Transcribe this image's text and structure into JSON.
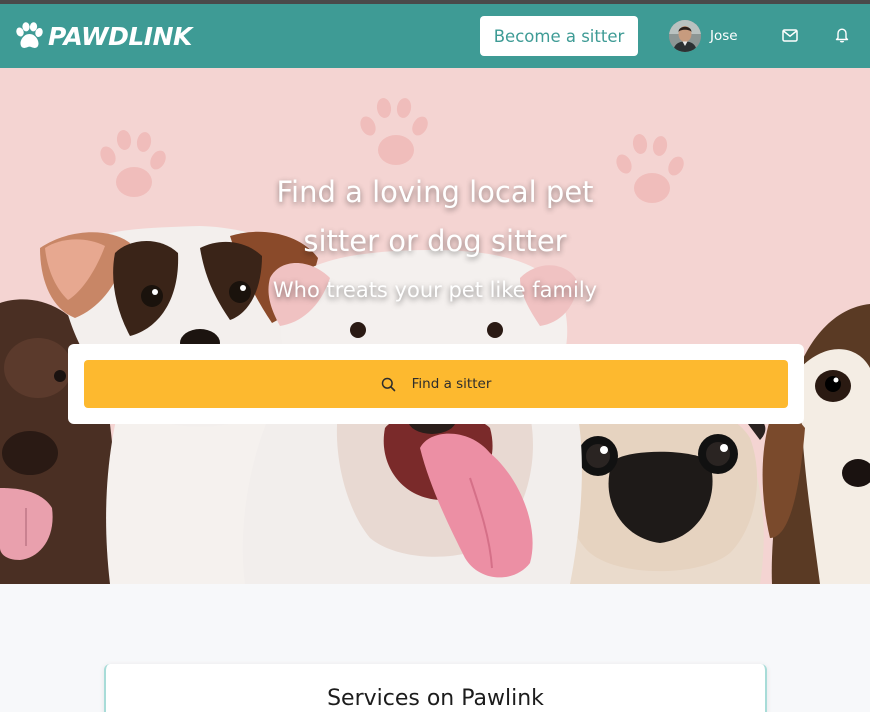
{
  "navbar": {
    "brand": "PAWDLINK",
    "become_sitter_label": "Become a sitter",
    "user_name": "Jose",
    "icons": {
      "logo": "paw-icon",
      "messages": "mail-icon",
      "notifications": "bell-icon"
    },
    "background_color": "#3e9b95"
  },
  "hero": {
    "title": "Find a loving local pet sitter or dog sitter",
    "subtitle": "Who treats your pet like family",
    "find_button_label": "Find a sitter",
    "find_button_icon": "search-icon",
    "button_color": "#fdb92f",
    "background_color": "#f4d4d2"
  },
  "services": {
    "title": "Services on Pawlink"
  }
}
